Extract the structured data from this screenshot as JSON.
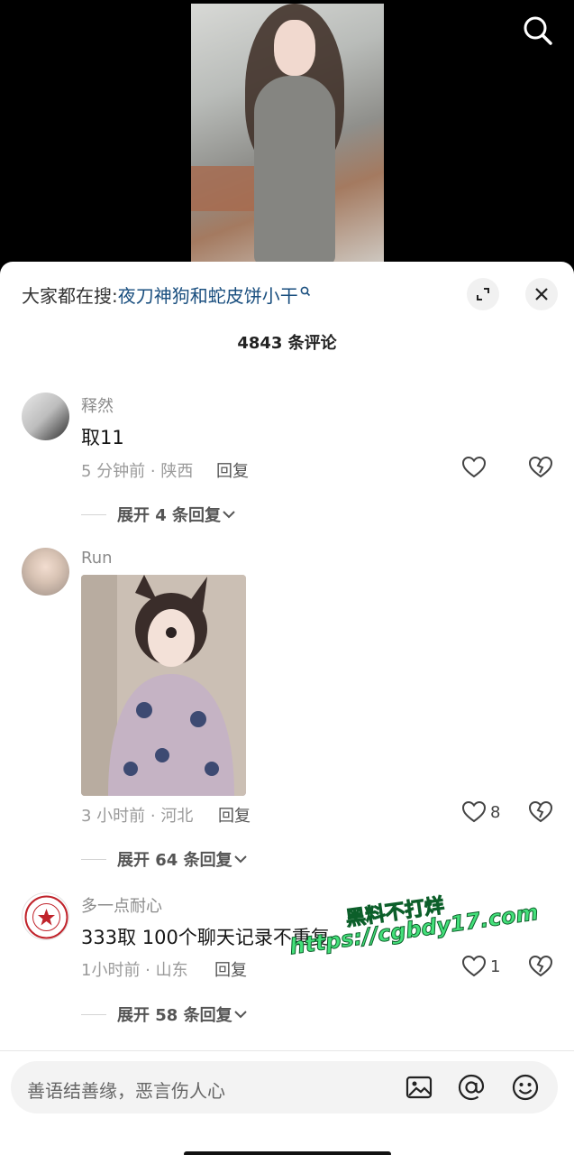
{
  "hot_search": {
    "prefix": "大家都在搜:",
    "term": "夜刀神狗和蛇皮饼小干"
  },
  "comments_header": {
    "count_title": "4843 条评论"
  },
  "comments": [
    {
      "username": "释然",
      "text": "取11",
      "meta": "5 分钟前 · 陕西",
      "reply_label": "回复",
      "likes": "",
      "expand_label": "展开 4 条回复"
    },
    {
      "username": "Run",
      "text": "",
      "meta": "3 小时前 · 河北",
      "reply_label": "回复",
      "likes": "8",
      "expand_label": "展开 64 条回复"
    },
    {
      "username": "多一点耐心",
      "text": "333取 100个聊天记录不重复",
      "meta": "1小时前 · 山东",
      "reply_label": "回复",
      "likes": "1",
      "expand_label": "展开 58 条回复"
    }
  ],
  "input": {
    "placeholder": "善语结善缘，恶言伤人心"
  },
  "watermark": {
    "line1": "黑料不打烊",
    "line2": "https://cgbdy17.com"
  },
  "colors": {
    "hot_term": "#1a4f7f",
    "watermark": "#44e07a"
  }
}
